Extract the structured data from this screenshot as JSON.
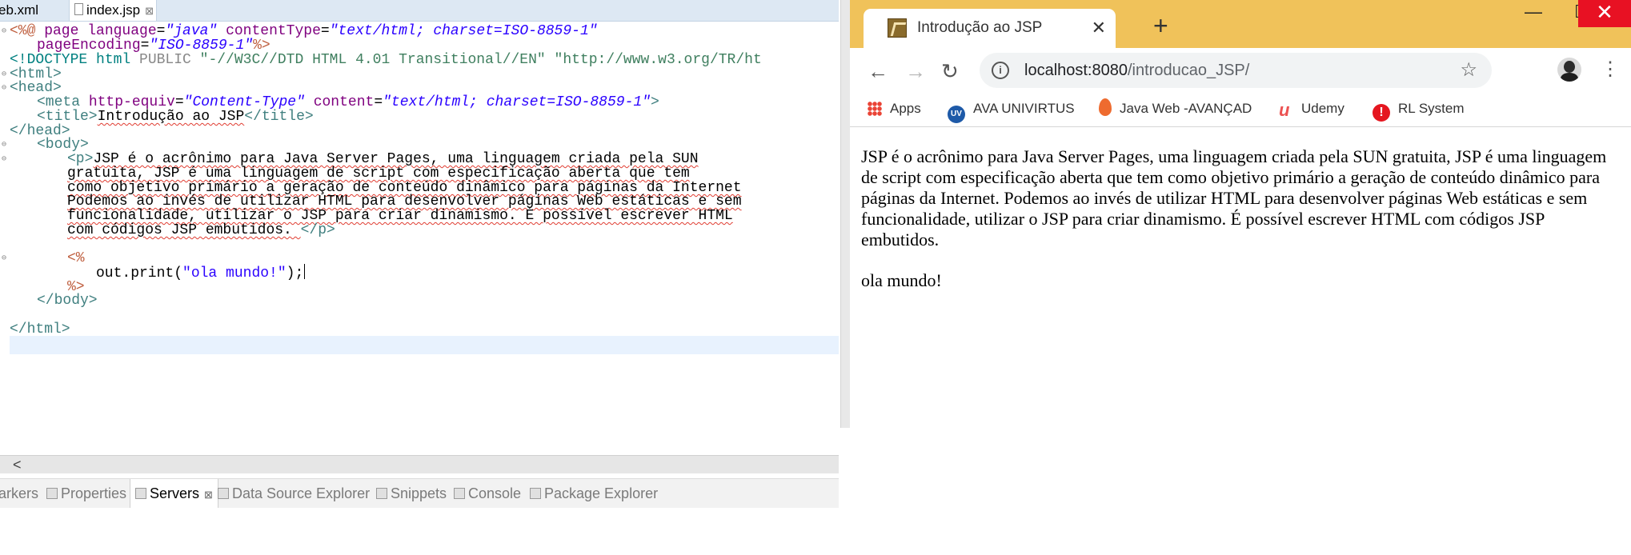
{
  "eclipse": {
    "tabs": [
      {
        "label": "eb.xml"
      },
      {
        "label": "index.jsp",
        "close": "⊠"
      }
    ],
    "code": {
      "line1": {
        "open": "<%@",
        "kw": " page ",
        "a1": "language",
        "v1": "\"java\"",
        "a2": " contentType",
        "v2": "\"text/html; charset=ISO-8859-1\""
      },
      "line2": {
        "attr": "pageEncoding",
        "val": "\"ISO-8859-1\"",
        "close": "%>"
      },
      "line3": {
        "doctype": "<!DOCTYPE html ",
        "public": "PUBLIC",
        "str": " \"-//W3C//DTD HTML 4.01 Transitional//EN\" \"http://www.w3.org/TR/ht"
      },
      "line4": "<html>",
      "line5": "<head>",
      "line6": {
        "tag": "<meta",
        "a1": " http-equiv",
        "v1": "\"Content-Type\"",
        "a2": " content",
        "v2": "\"text/html; charset=ISO-8859-1\"",
        "end": ">"
      },
      "line7": {
        "open": "<title>",
        "text": "Introdução ao JSP",
        "close": "</title>"
      },
      "line8": "</head>",
      "line9": "<body>",
      "line10": {
        "tag": "<p>",
        "text": "JSP é o acrônimo para Java Server Pages, uma linguagem criada pela SUN"
      },
      "line11": "gratuita, JSP é uma linguagem de script com especificação aberta que tem",
      "line12": "como objetivo primário a geração de conteúdo dinâmico para páginas da Internet",
      "line13": "Podemos ao invés de utilizar HTML para desenvolver páginas Web estáticas e sem",
      "line14": "funcionalidade, utilizar o JSP para criar dinamismo. É possível escrever HTML",
      "line15": {
        "text": "com códigos JSP embutidos. ",
        "tag": "</p>"
      },
      "line17": "<%",
      "line18": {
        "pre": "out.print(",
        "str": "\"ola mundo!\"",
        "post": ");"
      },
      "line19": "%>",
      "line20": "</body>",
      "line22": "</html>"
    },
    "hscroll_arrow": "<",
    "views": [
      {
        "label": "arkers"
      },
      {
        "label": "Properties"
      },
      {
        "label": "Servers",
        "close": "⊠"
      },
      {
        "label": "Data Source Explorer"
      },
      {
        "label": "Snippets"
      },
      {
        "label": "Console"
      },
      {
        "label": "Package Explorer"
      }
    ]
  },
  "chrome": {
    "tab_title": "Introdução ao JSP",
    "tab_close": "✕",
    "new_tab": "+",
    "window": {
      "minimize": "—",
      "maximize": "☐",
      "close": "✕"
    },
    "nav": {
      "back": "←",
      "forward": "→",
      "reload": "↻"
    },
    "url": {
      "host": "localhost:8080",
      "path": "/introducao_JSP/"
    },
    "info": "i",
    "star": "☆",
    "menu": "⋮",
    "bookmarks": [
      {
        "label": "Apps"
      },
      {
        "label": "AVA UNIVIRTUS",
        "icon_text": "UV"
      },
      {
        "label": "Java Web -AVANÇAD"
      },
      {
        "label": "Udemy",
        "icon_text": "u"
      },
      {
        "label": "RL System",
        "icon_text": "!"
      }
    ],
    "page": {
      "paragraph": "JSP é o acrônimo para Java Server Pages, uma linguagem criada pela SUN gratuita, JSP é uma linguagem de script com especificação aberta que tem como objetivo primário a geração de conteúdo dinâmico para páginas da Internet. Podemos ao invés de utilizar HTML para desenvolver páginas Web estáticas e sem funcionalidade, utilizar o JSP para criar dinamismo. É possível escrever HTML com códigos JSP embutidos.",
      "output": "ola mundo!"
    }
  },
  "colors": {
    "chrome_frame": "#f0c25a",
    "close_button": "#e81123",
    "jsp_delimiter": "#bf5f3f",
    "html_tag": "#3f7f7f",
    "attribute": "#7f007f",
    "attribute_value": "#2a00ff"
  }
}
